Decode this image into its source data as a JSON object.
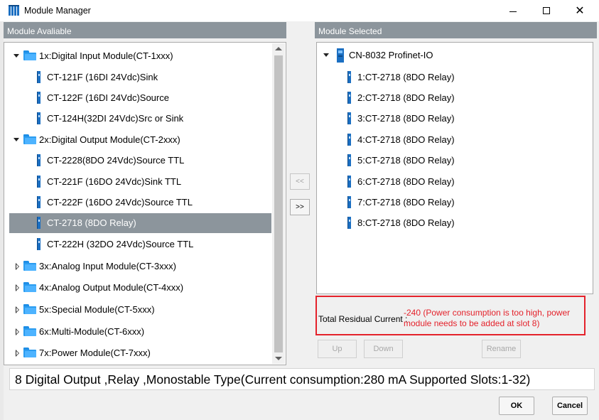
{
  "window": {
    "title": "Module Manager",
    "controls": {
      "minimize": "minimize",
      "maximize": "maximize",
      "close": "✕"
    }
  },
  "left_panel": {
    "header": "Module Avaliable",
    "tree": [
      {
        "label": "1x:Digital Input Module(CT-1xxx)",
        "expanded": true,
        "children": [
          "CT-121F (16DI 24Vdc)Sink",
          "CT-122F (16DI 24Vdc)Source",
          "CT-124H(32DI 24Vdc)Src or Sink"
        ]
      },
      {
        "label": "2x:Digital Output Module(CT-2xxx)",
        "expanded": true,
        "children": [
          "CT-2228(8DO 24Vdc)Source TTL",
          "CT-221F (16DO 24Vdc)Sink TTL",
          "CT-222F (16DO 24Vdc)Source TTL",
          "CT-2718 (8DO Relay)",
          "CT-222H (32DO 24Vdc)Source TTL"
        ]
      },
      {
        "label": "3x:Analog Input Module(CT-3xxx)",
        "expanded": false
      },
      {
        "label": "4x:Analog Output Module(CT-4xxx)",
        "expanded": false
      },
      {
        "label": "5x:Special Module(CT-5xxx)",
        "expanded": false
      },
      {
        "label": "6x:Multi-Module(CT-6xxx)",
        "expanded": false
      },
      {
        "label": "7x:Power Module(CT-7xxx)",
        "expanded": false
      }
    ],
    "selected_item": "CT-2718 (8DO Relay)"
  },
  "middle_buttons": {
    "remove": "<<",
    "add": ">>"
  },
  "right_panel": {
    "header": "Module Selected",
    "root": "CN-8032 Profinet-IO",
    "children": [
      "1:CT-2718 (8DO Relay)",
      "2:CT-2718 (8DO Relay)",
      "3:CT-2718 (8DO Relay)",
      "4:CT-2718 (8DO Relay)",
      "5:CT-2718 (8DO Relay)",
      "6:CT-2718 (8DO Relay)",
      "7:CT-2718 (8DO Relay)",
      "8:CT-2718 (8DO Relay)"
    ]
  },
  "residual": {
    "label": "Total Residual Current :",
    "value": "-240 (Power consumption is too high, power module needs to be added at slot 8)",
    "highlight_color": "#e4222b"
  },
  "list_buttons": {
    "up": "Up",
    "down": "Down",
    "rename": "Rename"
  },
  "description": "8 Digital Output ,Relay ,Monostable Type(Current consumption:280 mA  Supported Slots:1-32)",
  "dialog_buttons": {
    "ok": "OK",
    "cancel": "Cancel"
  }
}
